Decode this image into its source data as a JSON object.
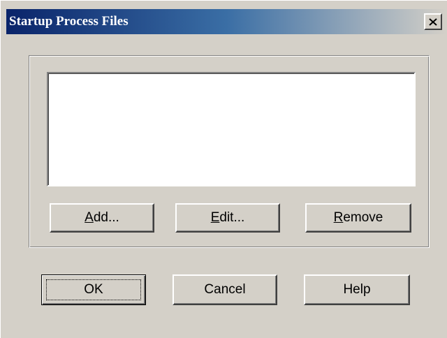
{
  "window": {
    "title": "Startup Process Files",
    "close_icon": "close-x-icon"
  },
  "group": {
    "list_items": [],
    "buttons": {
      "add": {
        "mnemonic": "A",
        "rest": "dd..."
      },
      "edit": {
        "mnemonic": "E",
        "rest": "dit..."
      },
      "remove": {
        "mnemonic": "R",
        "rest": "emove"
      }
    }
  },
  "footer": {
    "ok_label": "OK",
    "cancel_label": "Cancel",
    "help_label": "Help"
  }
}
